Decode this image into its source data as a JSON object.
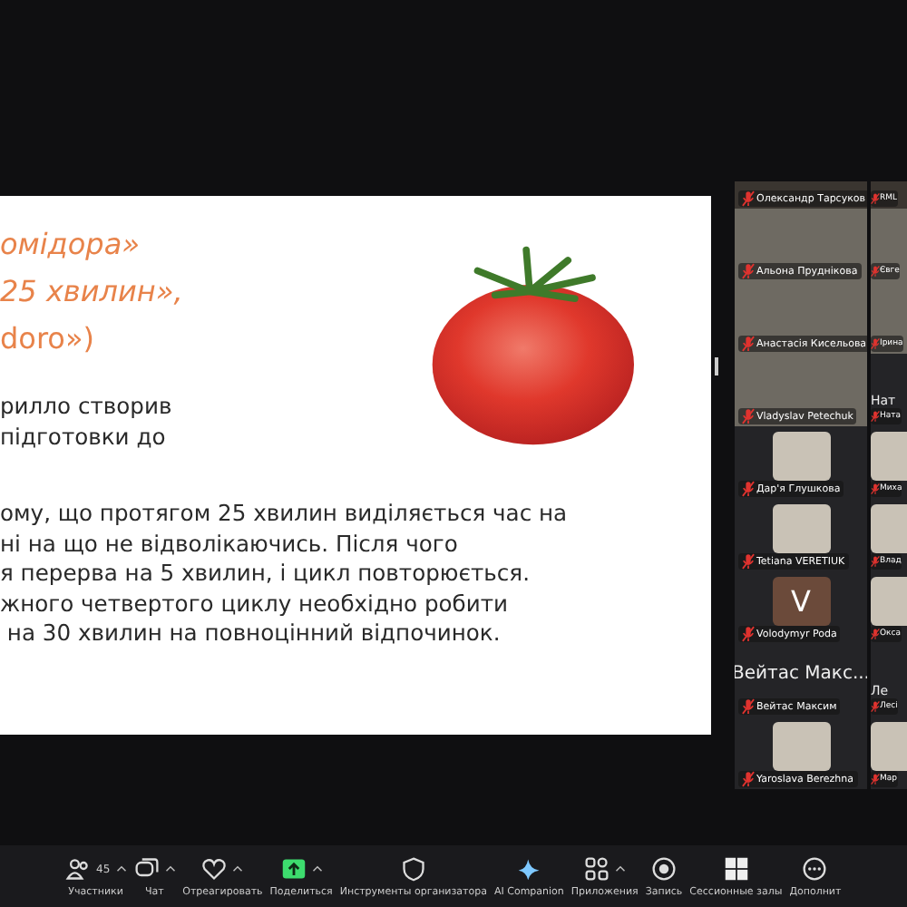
{
  "slide": {
    "title_lines": [
      {
        "text": "омідора»",
        "italic": true
      },
      {
        "text": "25 хвилин»,",
        "italic": true
      },
      {
        "text": "doro»)",
        "italic": false
      }
    ],
    "intro_lines": [
      "рилло створив",
      "підготовки до"
    ],
    "body_lines": [
      "ому, що протягом 25 хвилин виділяється час на",
      "ні на що не відволікаючись. Після чого",
      "я перерва на 5 хвилин, і цикл повторюється.",
      "жного четвертого циклу необхідно робити",
      " на 30 хвилин на повноцінний відпочинок."
    ]
  },
  "gallery_rows": [
    {
      "tiles": [
        {
          "name": "Олександр Тарсуков",
          "kind": "video",
          "muted": true
        },
        {
          "name": "RML",
          "kind": "video",
          "muted": true
        }
      ]
    },
    {
      "tiles": [
        {
          "name": "Альона Пруднікова",
          "kind": "video",
          "muted": true
        },
        {
          "name": "Євге",
          "kind": "video",
          "muted": true
        }
      ]
    },
    {
      "tiles": [
        {
          "name": "Анастасія Кисельова",
          "kind": "video",
          "muted": true
        },
        {
          "name": "Ірина",
          "kind": "video",
          "muted": true
        }
      ]
    },
    {
      "tiles": [
        {
          "name": "Vladyslav Petechuk",
          "kind": "video",
          "muted": true
        },
        {
          "name": "Ната",
          "kind": "name",
          "muted": true,
          "display": "Нат"
        }
      ]
    },
    {
      "tiles": [
        {
          "name": "Дар'я Глушкова",
          "kind": "photo",
          "muted": true
        },
        {
          "name": "Миха",
          "kind": "photo",
          "muted": true
        }
      ]
    },
    {
      "tiles": [
        {
          "name": "Tetiana VERETIUK",
          "kind": "photo",
          "muted": true
        },
        {
          "name": "Влад",
          "kind": "photo",
          "muted": true
        }
      ]
    },
    {
      "tiles": [
        {
          "name": "Volodymyr Poda",
          "kind": "letter",
          "display": "V",
          "color": "#6b4a3a",
          "muted": true
        },
        {
          "name": "Окса",
          "kind": "photo",
          "muted": true
        }
      ]
    },
    {
      "tiles": [
        {
          "name": "Вейтас Максим",
          "kind": "name",
          "muted": true,
          "display": "Вейтас Макс..."
        },
        {
          "name": "Лесі",
          "kind": "name",
          "muted": true,
          "display": "Ле"
        }
      ]
    },
    {
      "tiles": [
        {
          "name": "Yaroslava Berezhna",
          "kind": "photo",
          "muted": true
        },
        {
          "name": "Мар",
          "kind": "photo",
          "muted": true
        }
      ]
    }
  ],
  "toolbar": [
    {
      "label": "Участники",
      "kind": "people",
      "badge": "45",
      "caret": true
    },
    {
      "label": "Чат",
      "kind": "chat",
      "caret": true
    },
    {
      "label": "Отреагировать",
      "kind": "heart",
      "caret": true
    },
    {
      "label": "Поделиться",
      "kind": "share",
      "caret": true
    },
    {
      "label": "Инструменты организатора",
      "kind": "shield",
      "caret": false
    },
    {
      "label": "AI Companion",
      "kind": "sparkle",
      "caret": false
    },
    {
      "label": "Приложения",
      "kind": "apps",
      "caret": true
    },
    {
      "label": "Запись",
      "kind": "record",
      "caret": false
    },
    {
      "label": "Сессионные залы",
      "kind": "grid",
      "caret": false
    },
    {
      "label": "Дополнит",
      "kind": "more",
      "caret": false
    }
  ]
}
